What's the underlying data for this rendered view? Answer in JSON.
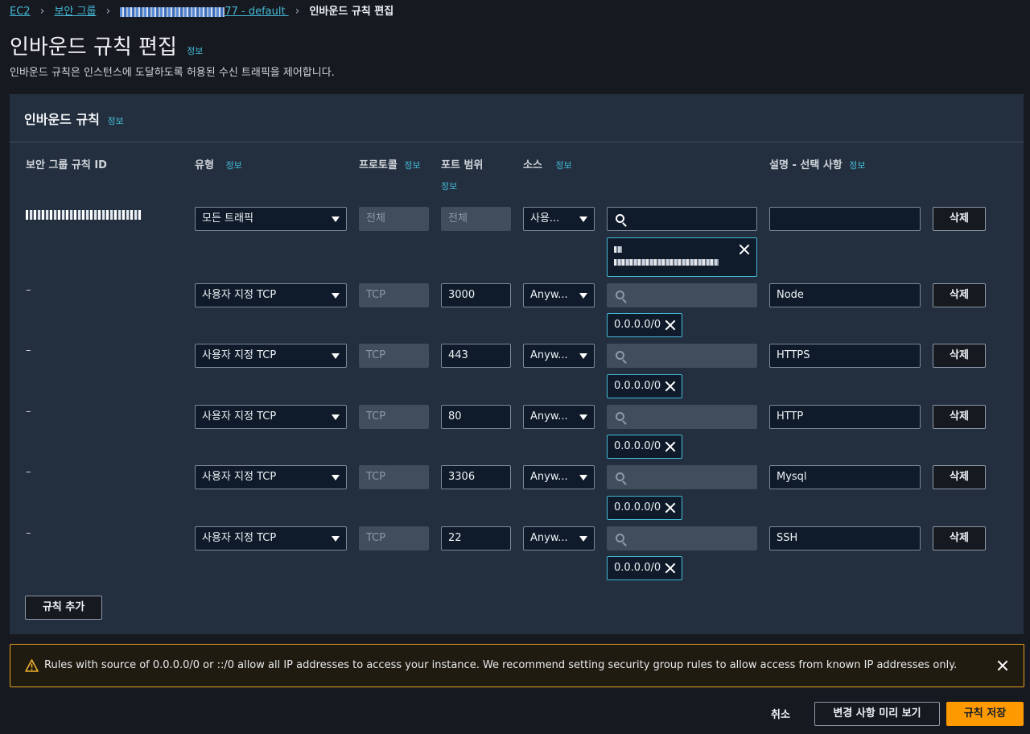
{
  "breadcrumb": {
    "items": [
      "EC2",
      "보안 그룹",
      "77 - default",
      "인바운드 규칙 편집"
    ]
  },
  "page": {
    "title": "인바운드 규칙 편집",
    "info": "정보",
    "subtitle": "인바운드 규칙은 인스턴스에 도달하도록 허용된 수신 트래픽을 제어합니다."
  },
  "panel": {
    "title": "인바운드 규칙",
    "info": "정보",
    "columns": {
      "rule_id": "보안 그룹 규칙 ID",
      "type": "유형",
      "type_info": "정보",
      "protocol": "프로토콜",
      "protocol_info": "정보",
      "port": "포트 범위",
      "port_info": "정보",
      "source": "소스",
      "source_info": "정보",
      "description": "설명 - 선택 사항",
      "description_info": "정보"
    },
    "rules": [
      {
        "rule_id": "–",
        "type": "모든 트래픽",
        "protocol": "전체",
        "port": "전체",
        "source": "사용...",
        "cidr": "",
        "description": "",
        "delete": "삭제"
      },
      {
        "rule_id": "–",
        "type": "사용자 지정 TCP",
        "protocol": "TCP",
        "port": "3000",
        "source": "Anyw...",
        "cidr": "0.0.0.0/0",
        "description": "Node",
        "delete": "삭제"
      },
      {
        "rule_id": "–",
        "type": "사용자 지정 TCP",
        "protocol": "TCP",
        "port": "443",
        "source": "Anyw...",
        "cidr": "0.0.0.0/0",
        "description": "HTTPS",
        "delete": "삭제"
      },
      {
        "rule_id": "–",
        "type": "사용자 지정 TCP",
        "protocol": "TCP",
        "port": "80",
        "source": "Anyw...",
        "cidr": "0.0.0.0/0",
        "description": "HTTP",
        "delete": "삭제"
      },
      {
        "rule_id": "–",
        "type": "사용자 지정 TCP",
        "protocol": "TCP",
        "port": "3306",
        "source": "Anyw...",
        "cidr": "0.0.0.0/0",
        "description": "Mysql",
        "delete": "삭제"
      },
      {
        "rule_id": "–",
        "type": "사용자 지정 TCP",
        "protocol": "TCP",
        "port": "22",
        "source": "Anyw...",
        "cidr": "0.0.0.0/0",
        "description": "SSH",
        "delete": "삭제"
      }
    ],
    "add_rule": "규칙 추가"
  },
  "warning": {
    "text": "Rules with source of 0.0.0.0/0 or ::/0 allow all IP addresses to access your instance. We recommend setting security group rules to allow access from known IP addresses only.",
    "icon": "warning-icon",
    "color": "#f2b12c"
  },
  "footer": {
    "cancel": "취소",
    "preview": "변경 사항 미리 보기",
    "save": "규칙 저장"
  },
  "colors": {
    "accent": "#ff9900",
    "link": "#44b9d6",
    "background": "#16191f"
  }
}
